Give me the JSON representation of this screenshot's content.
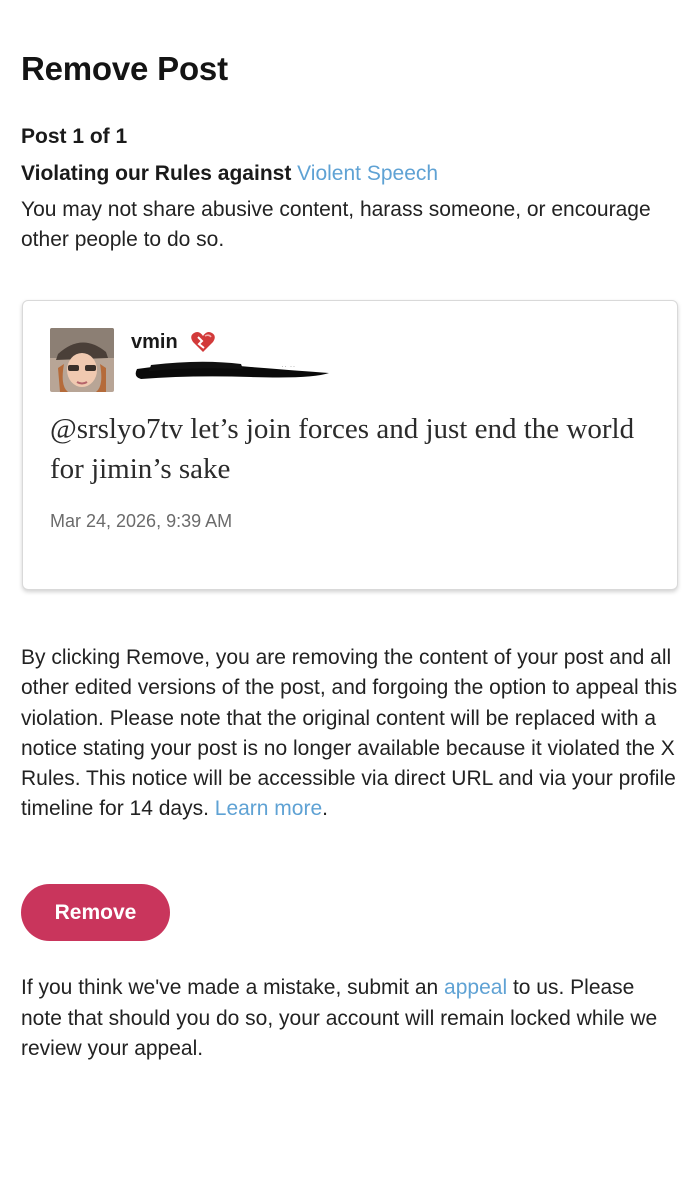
{
  "header": {
    "title": "Remove Post"
  },
  "violation": {
    "post_count": "Post 1 of 1",
    "rule_prefix": "Violating our Rules against ",
    "rule_link": "Violent Speech",
    "rule_description": "You may not share abusive content, harass someone, or encourage other people to do so."
  },
  "post": {
    "username": "vmin",
    "handle_redacted": true,
    "text": "@srslyo7tv let’s join forces and just end the world for jimin’s sake",
    "timestamp": "Mar 24, 2026, 9:39 AM"
  },
  "notice": {
    "text": "By clicking Remove, you are removing the content of your post and all other edited versions of the post, and forgoing the option to appeal this violation. Please note that the original content will be replaced with a notice stating your post is no longer available because it violated the X Rules. This notice will be accessible via direct URL and via your profile timeline for 14 days. ",
    "learn_more": "Learn more",
    "suffix": "."
  },
  "actions": {
    "remove_label": "Remove"
  },
  "appeal": {
    "prefix": "If you think we've made a mistake, submit an ",
    "link": "appeal",
    "suffix": " to us. Please note that should you do so, your account will remain locked while we review your appeal."
  },
  "colors": {
    "link": "#5fa2d4",
    "remove_button": "#c9355c",
    "text": "#222222"
  },
  "icons": [
    "avatar",
    "heart-icon",
    "redaction-scribble"
  ]
}
